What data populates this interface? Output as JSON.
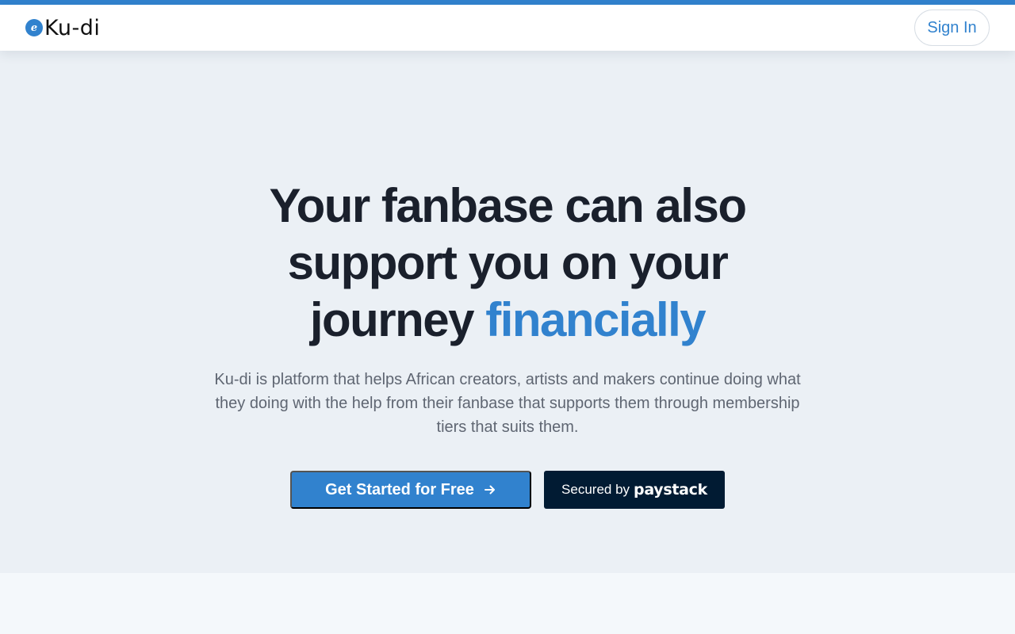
{
  "colors": {
    "accent": "#3182ce",
    "heading": "#1a202c",
    "body_text": "#5f6672",
    "hero_background": "#ebf0f5",
    "paystack_background": "#011b33"
  },
  "header": {
    "logo_badge": "e",
    "logo_text": "Ku-di",
    "sign_in_label": "Sign In"
  },
  "hero": {
    "headline_line1": "Your fanbase can also",
    "headline_line2": "support you on your",
    "headline_line3_prefix": "journey",
    "headline_accent": "financially",
    "description": "Ku-di is platform that helps African creators, artists and makers continue doing what they doing with the help from their fanbase that supports them through membership tiers that suits them.",
    "cta_label": "Get Started for Free",
    "cta_icon": "arrow-right-icon",
    "paystack_secured_label": "Secured by",
    "paystack_brand": "paystack"
  }
}
